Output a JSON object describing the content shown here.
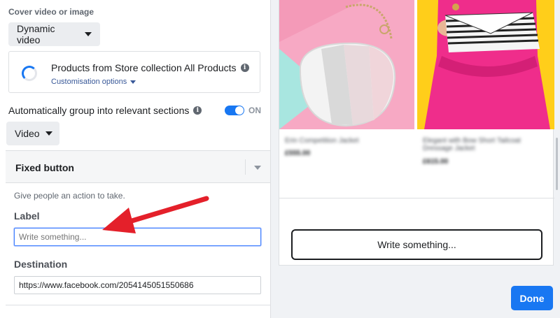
{
  "cover": {
    "section_label": "Cover video or image",
    "media_type_selected": "Dynamic video",
    "product_source": {
      "title": "Products from Store collection All Products",
      "customisation_link": "Customisation options"
    }
  },
  "grouping": {
    "label": "Automatically group into relevant sections",
    "toggle_state": "ON",
    "toggle_on": true,
    "section_type_selected": "Video"
  },
  "fixed_button": {
    "title": "Fixed button",
    "helper_text": "Give people an action to take.",
    "label_field": {
      "label": "Label",
      "value": "",
      "placeholder": "Write something..."
    },
    "destination_field": {
      "label": "Destination",
      "value": "https://www.facebook.com/2054145051550686"
    }
  },
  "preview": {
    "products": [
      {
        "name": "Erin Competition Jacket",
        "price": "£555.00"
      },
      {
        "name": "Elegant with Bow Short Tailcoat Dressage Jacket",
        "price": "£615.00"
      }
    ],
    "cta_label": "Write something..."
  },
  "footer": {
    "done_label": "Done"
  },
  "colors": {
    "accent": "#1877f2",
    "link": "#385898",
    "annotation_arrow": "#e4202a"
  }
}
